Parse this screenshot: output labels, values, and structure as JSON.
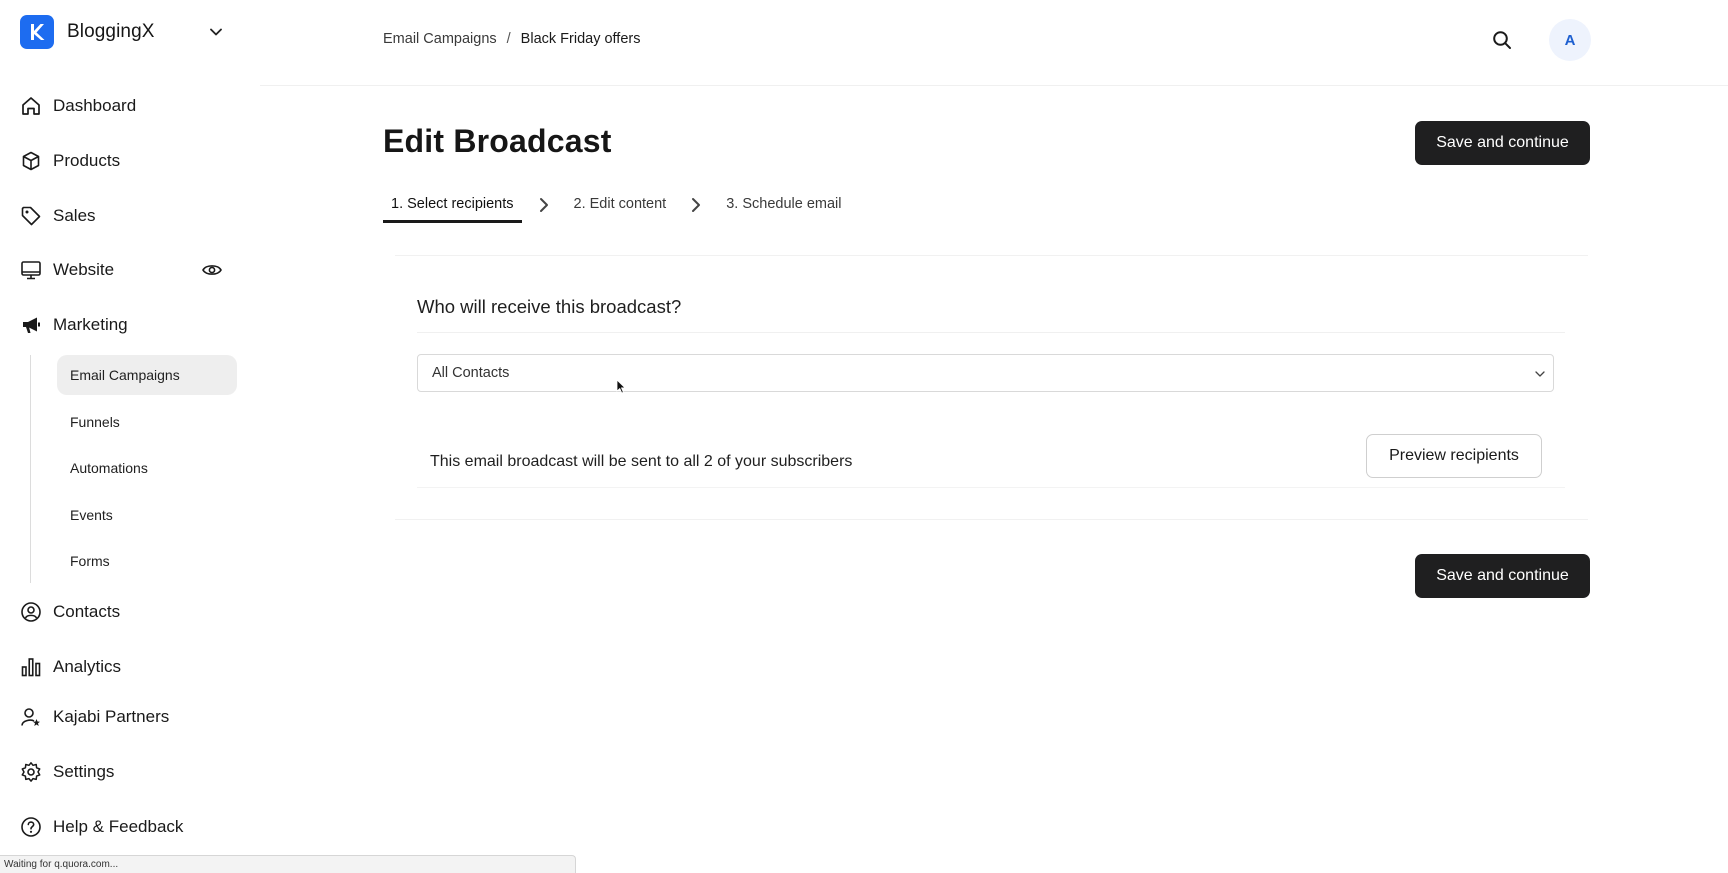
{
  "workspace": {
    "name": "BloggingX",
    "logo_letter": "K"
  },
  "sidebar": {
    "items": [
      {
        "label": "Dashboard",
        "icon": "home-icon"
      },
      {
        "label": "Products",
        "icon": "box-icon"
      },
      {
        "label": "Sales",
        "icon": "tag-icon"
      },
      {
        "label": "Website",
        "icon": "monitor-icon"
      },
      {
        "label": "Marketing",
        "icon": "megaphone-icon"
      },
      {
        "label": "Contacts",
        "icon": "user-circle-icon"
      },
      {
        "label": "Analytics",
        "icon": "bar-chart-icon"
      },
      {
        "label": "Kajabi Partners",
        "icon": "user-star-icon"
      },
      {
        "label": "Settings",
        "icon": "gear-icon"
      },
      {
        "label": "Help & Feedback",
        "icon": "help-circle-icon"
      }
    ],
    "marketing_subitems": [
      {
        "label": "Email Campaigns",
        "active": true
      },
      {
        "label": "Funnels"
      },
      {
        "label": "Automations"
      },
      {
        "label": "Events"
      },
      {
        "label": "Forms"
      }
    ]
  },
  "header": {
    "breadcrumb": {
      "parent": "Email Campaigns",
      "separator": "/",
      "current": "Black Friday offers"
    },
    "avatar_initial": "A"
  },
  "main": {
    "title": "Edit Broadcast",
    "save_label": "Save and continue",
    "steps": [
      {
        "label": "1. Select recipients",
        "active": true
      },
      {
        "label": "2. Edit content"
      },
      {
        "label": "3. Schedule email"
      }
    ],
    "recipients": {
      "question": "Who will receive this broadcast?",
      "selected_option": "All Contacts",
      "summary": "This email broadcast will be sent to all 2 of your subscribers",
      "preview_label": "Preview recipients"
    }
  },
  "status_bar": {
    "text": "Waiting for q.quora.com..."
  },
  "colors": {
    "brand": "#1d6cf0",
    "primary_button": "#1f1f20",
    "avatar_bg": "#eef3fd",
    "avatar_text": "#1d5fd0"
  }
}
